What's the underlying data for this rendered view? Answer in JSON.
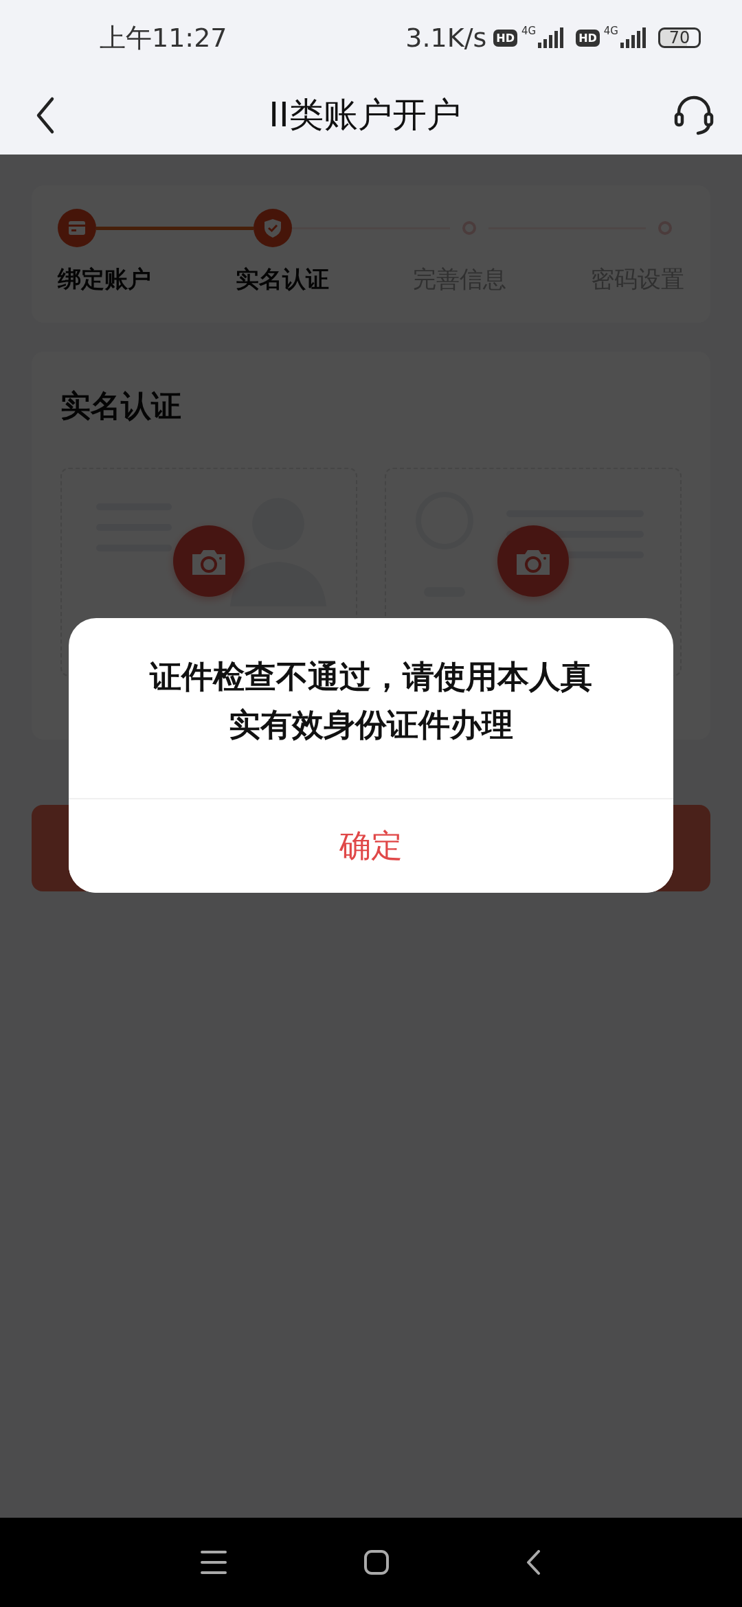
{
  "status_bar": {
    "time": "上午11:27",
    "net_speed": "3.1K/s",
    "sims": [
      {
        "hd": "HD",
        "network": "4G"
      },
      {
        "hd": "HD",
        "network": "4G"
      }
    ],
    "battery": "70"
  },
  "header": {
    "title": "II类账户开户"
  },
  "steps": [
    {
      "label": "绑定账户",
      "kind": "card",
      "active": true
    },
    {
      "label": "实名认证",
      "kind": "shield",
      "active": true
    },
    {
      "label": "完善信息",
      "kind": "dot",
      "active": false
    },
    {
      "label": "密码设置",
      "kind": "dot",
      "active": false
    }
  ],
  "verification": {
    "title": "实名认证",
    "id_cards": [
      {
        "kind": "portrait_side"
      },
      {
        "kind": "emblem_side"
      }
    ]
  },
  "dialog": {
    "message": "证件检查不通过，请使用本人真实有效身份证件办理",
    "button": "确定"
  }
}
